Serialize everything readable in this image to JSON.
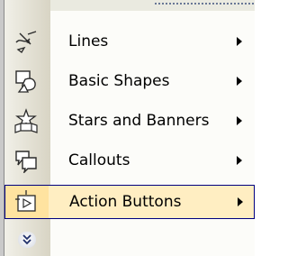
{
  "menu": {
    "items": [
      {
        "label": "Lines",
        "icon": "lines-icon",
        "has_submenu": true
      },
      {
        "label": "Basic Shapes",
        "icon": "basic-shapes-icon",
        "has_submenu": true
      },
      {
        "label": "Stars and Banners",
        "icon": "stars-and-banners-icon",
        "has_submenu": true
      },
      {
        "label": "Callouts",
        "icon": "callouts-icon",
        "has_submenu": true
      },
      {
        "label": "Action Buttons",
        "icon": "action-buttons-icon",
        "has_submenu": true,
        "selected": true
      }
    ],
    "expand_icon": "double-chevron-down-icon"
  },
  "colors": {
    "highlight_fill": "#ffeec2",
    "highlight_border": "#000080",
    "gutter": "#d8d4c4",
    "background": "#fcfcf9"
  }
}
